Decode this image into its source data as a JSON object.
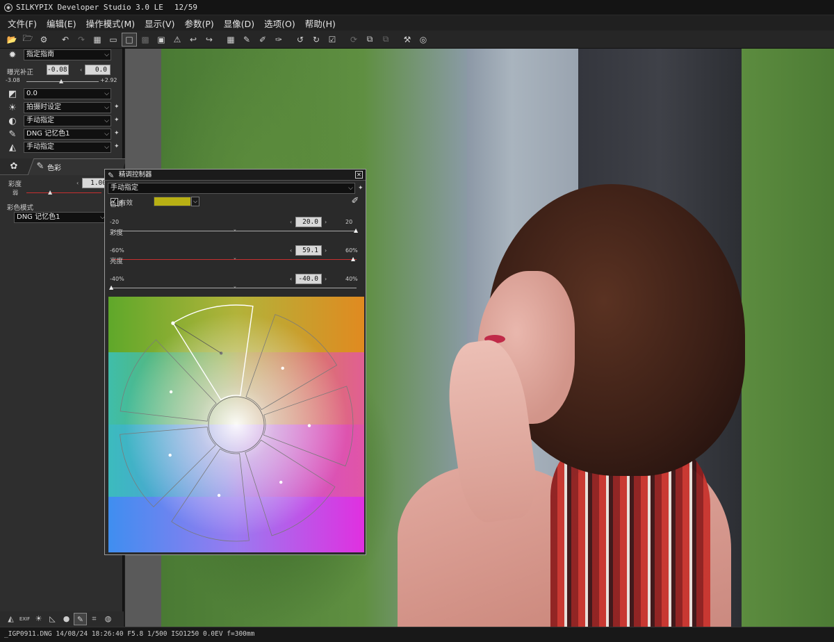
{
  "app": {
    "title": "SILKYPIX Developer Studio 3.0 LE",
    "counter": "12/59"
  },
  "menu": [
    {
      "label": "文件(F)"
    },
    {
      "label": "编辑(E)"
    },
    {
      "label": "操作模式(M)"
    },
    {
      "label": "显示(V)"
    },
    {
      "label": "参数(P)"
    },
    {
      "label": "显像(D)"
    },
    {
      "label": "选项(O)"
    },
    {
      "label": "帮助(H)"
    }
  ],
  "toolbar": [
    {
      "icon": "open-folder-icon",
      "glyph": "📂"
    },
    {
      "icon": "folder-options-icon",
      "glyph": "🗁"
    },
    {
      "icon": "develop-icon",
      "glyph": "⚙"
    },
    {
      "sep": true
    },
    {
      "icon": "undo-icon",
      "glyph": "↶"
    },
    {
      "icon": "redo-icon",
      "glyph": "↷",
      "dim": true
    },
    {
      "icon": "thumbnail-view-icon",
      "glyph": "▦"
    },
    {
      "icon": "filmstrip-view-icon",
      "glyph": "▭"
    },
    {
      "icon": "single-view-icon",
      "glyph": "□",
      "active": true
    },
    {
      "icon": "compare-view-icon",
      "glyph": "▩",
      "dim": true
    },
    {
      "icon": "fullscreen-icon",
      "glyph": "▣"
    },
    {
      "icon": "warning-icon",
      "glyph": "⚠"
    },
    {
      "icon": "prev-image-icon",
      "glyph": "↩"
    },
    {
      "icon": "next-image-icon",
      "glyph": "↪"
    },
    {
      "sep": true
    },
    {
      "icon": "grid-icon",
      "glyph": "▦"
    },
    {
      "icon": "pipette-gray-icon",
      "glyph": "✎"
    },
    {
      "icon": "pipette-white-icon",
      "glyph": "✐"
    },
    {
      "icon": "pipette-skin-icon",
      "glyph": "✑"
    },
    {
      "sep": true
    },
    {
      "icon": "rotate-left-icon",
      "glyph": "↺"
    },
    {
      "icon": "rotate-right-icon",
      "glyph": "↻"
    },
    {
      "icon": "checkmark-icon",
      "glyph": "☑"
    },
    {
      "sep": true
    },
    {
      "icon": "sync-icon",
      "glyph": "⟳",
      "dim": true
    },
    {
      "icon": "copy-params-icon",
      "glyph": "⧉"
    },
    {
      "icon": "paste-params-icon",
      "glyph": "⧉",
      "dim": true
    },
    {
      "sep": true
    },
    {
      "icon": "hammer-icon",
      "glyph": "⚒"
    },
    {
      "icon": "help-icon",
      "glyph": "◎"
    }
  ],
  "left_panel": {
    "taste": {
      "value": "指定指南"
    },
    "exposure": {
      "label": "曝光补正",
      "value": "-0.08",
      "min": "-3.08",
      "max": "+2.92",
      "right_value": "0.0"
    },
    "rows": [
      {
        "icon": "exposure-curve-icon",
        "glyph": "◩",
        "value": "0.0"
      },
      {
        "icon": "white-balance-icon",
        "glyph": "☀",
        "value": "拍摄时设定"
      },
      {
        "icon": "contrast-icon",
        "glyph": "◐",
        "value": "手动指定"
      },
      {
        "icon": "color-pen-icon",
        "glyph": "✎",
        "value": "DNG 记忆色1"
      },
      {
        "icon": "sharpness-icon",
        "glyph": "◭",
        "value": "手动指定"
      }
    ],
    "tab_label": "色彩",
    "saturation": {
      "label": "彩度",
      "value": "1.00",
      "min_label": "弱"
    },
    "color_mode": {
      "label": "彩色模式",
      "value": "DNG 记忆色1"
    }
  },
  "dialog": {
    "title": "精调控制器",
    "preset": "手动指定",
    "enabled_label": "有效",
    "swatch_color": "#b8b014",
    "hue": {
      "label": "色调",
      "min": "-20",
      "max": "20",
      "value": "20.0",
      "fraction": 1.0
    },
    "saturation": {
      "label": "彩度",
      "min": "-60%",
      "max": "60%",
      "value": "59.1",
      "fraction": 0.99
    },
    "brightness": {
      "label": "亮度",
      "min": "-40%",
      "max": "40%",
      "value": "-40.0",
      "fraction": 0.0
    }
  },
  "statusbar": {
    "text": "_IGP0911.DNG 14/08/24 18:26:40 F5.8 1/500 ISO1250 0.0EV f=300mm"
  }
}
